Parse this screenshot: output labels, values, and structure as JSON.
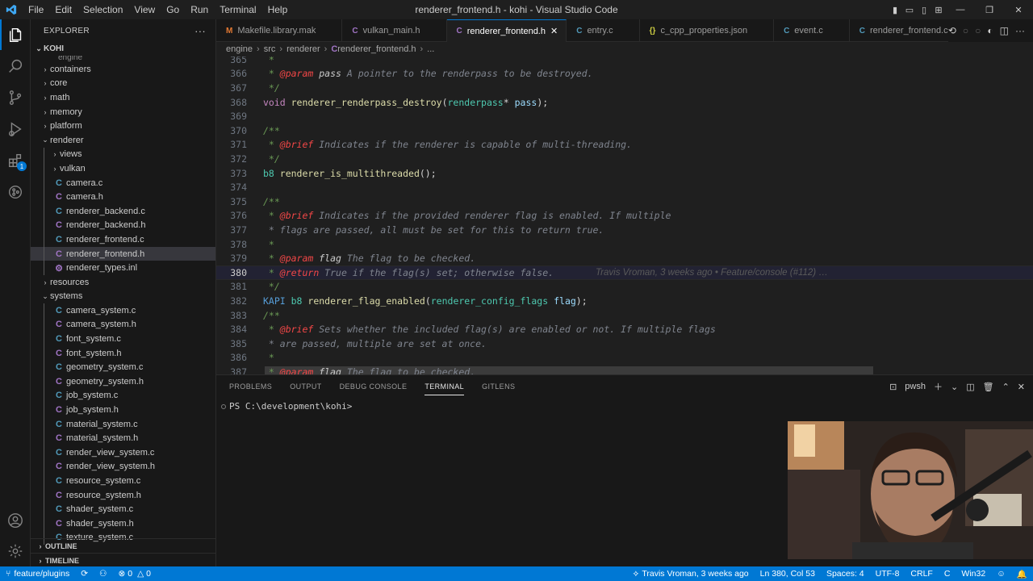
{
  "window": {
    "title": "renderer_frontend.h - kohi - Visual Studio Code",
    "menu": [
      "File",
      "Edit",
      "Selection",
      "View",
      "Go",
      "Run",
      "Terminal",
      "Help"
    ]
  },
  "sidebar": {
    "title": "EXPLORER",
    "root": "KOHI",
    "partial_top": "engine",
    "rows": [
      {
        "label": "containers",
        "kind": "folder",
        "depth": 1,
        "open": false
      },
      {
        "label": "core",
        "kind": "folder",
        "depth": 1,
        "open": false
      },
      {
        "label": "math",
        "kind": "folder",
        "depth": 1,
        "open": false
      },
      {
        "label": "memory",
        "kind": "folder",
        "depth": 1,
        "open": false
      },
      {
        "label": "platform",
        "kind": "folder",
        "depth": 1,
        "open": false
      },
      {
        "label": "renderer",
        "kind": "folder",
        "depth": 1,
        "open": true
      },
      {
        "label": "views",
        "kind": "folder",
        "depth": 2,
        "open": false
      },
      {
        "label": "vulkan",
        "kind": "folder",
        "depth": 2,
        "open": false
      },
      {
        "label": "camera.c",
        "kind": "c",
        "depth": 2
      },
      {
        "label": "camera.h",
        "kind": "h",
        "depth": 2
      },
      {
        "label": "renderer_backend.c",
        "kind": "c",
        "depth": 2
      },
      {
        "label": "renderer_backend.h",
        "kind": "h",
        "depth": 2
      },
      {
        "label": "renderer_frontend.c",
        "kind": "c",
        "depth": 2
      },
      {
        "label": "renderer_frontend.h",
        "kind": "h",
        "depth": 2,
        "selected": true
      },
      {
        "label": "renderer_types.inl",
        "kind": "inl",
        "depth": 2
      },
      {
        "label": "resources",
        "kind": "folder",
        "depth": 1,
        "open": false
      },
      {
        "label": "systems",
        "kind": "folder",
        "depth": 1,
        "open": true
      },
      {
        "label": "camera_system.c",
        "kind": "c",
        "depth": 2
      },
      {
        "label": "camera_system.h",
        "kind": "h",
        "depth": 2
      },
      {
        "label": "font_system.c",
        "kind": "c",
        "depth": 2
      },
      {
        "label": "font_system.h",
        "kind": "h",
        "depth": 2
      },
      {
        "label": "geometry_system.c",
        "kind": "c",
        "depth": 2
      },
      {
        "label": "geometry_system.h",
        "kind": "h",
        "depth": 2
      },
      {
        "label": "job_system.c",
        "kind": "c",
        "depth": 2
      },
      {
        "label": "job_system.h",
        "kind": "h",
        "depth": 2
      },
      {
        "label": "material_system.c",
        "kind": "c",
        "depth": 2
      },
      {
        "label": "material_system.h",
        "kind": "h",
        "depth": 2
      },
      {
        "label": "render_view_system.c",
        "kind": "c",
        "depth": 2
      },
      {
        "label": "render_view_system.h",
        "kind": "h",
        "depth": 2
      },
      {
        "label": "resource_system.c",
        "kind": "c",
        "depth": 2
      },
      {
        "label": "resource_system.h",
        "kind": "h",
        "depth": 2
      },
      {
        "label": "shader_system.c",
        "kind": "c",
        "depth": 2
      },
      {
        "label": "shader_system.h",
        "kind": "h",
        "depth": 2
      },
      {
        "label": "texture_system.c",
        "kind": "c",
        "depth": 2
      }
    ],
    "outline": "OUTLINE",
    "timeline": "TIMELINE"
  },
  "tabs": [
    {
      "label": "Makefile.library.mak",
      "icon": "M",
      "color": "#e37933"
    },
    {
      "label": "vulkan_main.h",
      "icon": "C",
      "color": "#a074c4"
    },
    {
      "label": "renderer_frontend.h",
      "icon": "C",
      "color": "#a074c4",
      "active": true
    },
    {
      "label": "entry.c",
      "icon": "C",
      "color": "#519aba"
    },
    {
      "label": "c_cpp_properties.json",
      "icon": "{}",
      "color": "#cbcb41"
    },
    {
      "label": "event.c",
      "icon": "C",
      "color": "#519aba"
    },
    {
      "label": "renderer_frontend.c",
      "icon": "C",
      "color": "#519aba"
    }
  ],
  "breadcrumb": [
    "engine",
    "src",
    "renderer",
    "renderer_frontend.h",
    "..."
  ],
  "code": {
    "lines": [
      {
        "n": "365",
        "segs": [
          {
            "t": " * ",
            "c": "cm"
          }
        ]
      },
      {
        "n": "366",
        "segs": [
          {
            "t": " * ",
            "c": "cm"
          },
          {
            "t": "@param",
            "c": "tag"
          },
          {
            "t": " pass ",
            "c": "pname"
          },
          {
            "t": "A pointer to the renderpass to be destroyed.",
            "c": "cm-dim"
          }
        ]
      },
      {
        "n": "367",
        "segs": [
          {
            "t": " */",
            "c": "cm"
          }
        ]
      },
      {
        "n": "368",
        "segs": [
          {
            "t": "void ",
            "c": "kw"
          },
          {
            "t": "renderer_renderpass_destroy",
            "c": "fn"
          },
          {
            "t": "(",
            "c": ""
          },
          {
            "t": "renderpass",
            "c": "ty"
          },
          {
            "t": "* ",
            "c": ""
          },
          {
            "t": "pass",
            "c": "var"
          },
          {
            "t": ");",
            "c": ""
          }
        ]
      },
      {
        "n": "369",
        "segs": []
      },
      {
        "n": "370",
        "segs": [
          {
            "t": "/**",
            "c": "cm"
          }
        ]
      },
      {
        "n": "371",
        "segs": [
          {
            "t": " * ",
            "c": "cm"
          },
          {
            "t": "@brief",
            "c": "tag"
          },
          {
            "t": " Indicates if the renderer is capable of multi-threading.",
            "c": "cm-dim"
          }
        ]
      },
      {
        "n": "372",
        "segs": [
          {
            "t": " */",
            "c": "cm"
          }
        ]
      },
      {
        "n": "373",
        "segs": [
          {
            "t": "b8 ",
            "c": "ty"
          },
          {
            "t": "renderer_is_multithreaded",
            "c": "fn"
          },
          {
            "t": "();",
            "c": ""
          }
        ]
      },
      {
        "n": "374",
        "segs": []
      },
      {
        "n": "375",
        "segs": [
          {
            "t": "/**",
            "c": "cm"
          }
        ]
      },
      {
        "n": "376",
        "segs": [
          {
            "t": " * ",
            "c": "cm"
          },
          {
            "t": "@brief",
            "c": "tag"
          },
          {
            "t": " Indicates if the provided renderer flag is enabled. If multiple",
            "c": "cm-dim"
          }
        ]
      },
      {
        "n": "377",
        "segs": [
          {
            "t": " * flags are passed, all must be set for this to return true.",
            "c": "cm-dim"
          }
        ]
      },
      {
        "n": "378",
        "segs": [
          {
            "t": " *",
            "c": "cm"
          }
        ]
      },
      {
        "n": "379",
        "segs": [
          {
            "t": " * ",
            "c": "cm"
          },
          {
            "t": "@param",
            "c": "tag"
          },
          {
            "t": " flag ",
            "c": "pname"
          },
          {
            "t": "The flag to be checked.",
            "c": "cm-dim"
          }
        ]
      },
      {
        "n": "380",
        "segs": [
          {
            "t": " * ",
            "c": "cm"
          },
          {
            "t": "@return",
            "c": "tag"
          },
          {
            "t": " True if the flag(s) set; otherwise false.",
            "c": "cm-dim"
          }
        ],
        "current": true
      },
      {
        "n": "381",
        "segs": [
          {
            "t": " */",
            "c": "cm"
          }
        ]
      },
      {
        "n": "382",
        "segs": [
          {
            "t": "KAPI ",
            "c": "mac"
          },
          {
            "t": "b8 ",
            "c": "ty"
          },
          {
            "t": "renderer_flag_enabled",
            "c": "fn"
          },
          {
            "t": "(",
            "c": ""
          },
          {
            "t": "renderer_config_flags",
            "c": "ty"
          },
          {
            "t": " ",
            "c": ""
          },
          {
            "t": "flag",
            "c": "var"
          },
          {
            "t": ");",
            "c": ""
          }
        ]
      },
      {
        "n": "383",
        "segs": [
          {
            "t": "/**",
            "c": "cm"
          }
        ]
      },
      {
        "n": "384",
        "segs": [
          {
            "t": " * ",
            "c": "cm"
          },
          {
            "t": "@brief",
            "c": "tag"
          },
          {
            "t": " Sets whether the included flag(s) are enabled or not. If multiple flags",
            "c": "cm-dim"
          }
        ]
      },
      {
        "n": "385",
        "segs": [
          {
            "t": " * are passed, multiple are set at once.",
            "c": "cm-dim"
          }
        ]
      },
      {
        "n": "386",
        "segs": [
          {
            "t": " *",
            "c": "cm"
          }
        ]
      },
      {
        "n": "387",
        "segs": [
          {
            "t": " * ",
            "c": "cm"
          },
          {
            "t": "@param",
            "c": "tag"
          },
          {
            "t": " flag ",
            "c": "pname"
          },
          {
            "t": "The flag to be checked.",
            "c": "cm-dim"
          }
        ]
      }
    ],
    "blame": "Travis Vroman, 3 weeks ago • Feature/console (#112) …"
  },
  "panel": {
    "tabs": [
      "PROBLEMS",
      "OUTPUT",
      "DEBUG CONSOLE",
      "TERMINAL",
      "GITLENS"
    ],
    "active_tab": "TERMINAL",
    "shell": "pwsh",
    "prompt": "PS C:\\development\\kohi>"
  },
  "statusbar": {
    "branch": "feature/plugins",
    "errors": "0",
    "warnings": "0",
    "blame": "Travis Vroman, 3 weeks ago",
    "position": "Ln 380, Col 53",
    "spaces": "Spaces: 4",
    "encoding": "UTF-8",
    "eol": "CRLF",
    "language": "C",
    "platform": "Win32"
  },
  "colors": {
    "accent": "#0078d4",
    "background": "#1f1f1f",
    "sidebar": "#181818"
  }
}
